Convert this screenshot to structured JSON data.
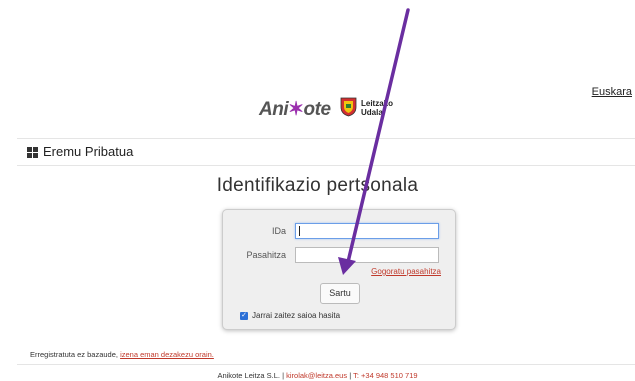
{
  "language": "Euskara",
  "logos": {
    "anikote_left": "Ani",
    "anikote_right": "ote",
    "leitzako_line1": "Leitzako",
    "leitzako_line2": "Udala"
  },
  "section": {
    "title": "Eremu Pribatua",
    "icon": "grid-icon"
  },
  "page_title": "Identifikazio pertsonala",
  "login": {
    "id_label": "IDa",
    "id_value": "",
    "password_label": "Pasahitza",
    "password_value": "",
    "forgot_link": "Gogoratu pasahitza",
    "submit_label": "Sartu",
    "keep_logged_in_label": "Jarrai zaitez saioa hasita",
    "keep_logged_in_checked": true
  },
  "register": {
    "text": "Erregistratuta ez bazaude,",
    "link": "izena eman dezakezu orain."
  },
  "footer": {
    "company": "Anikote Leitza S.L.",
    "sep1": "|",
    "email": "kirolak@leitza.eus",
    "sep2": "|",
    "phone": "T: +34 948 510 719"
  },
  "colors": {
    "accent_link": "#c0392b",
    "checkbox": "#2b6fd6",
    "annotation_arrow": "#6a2ea0",
    "anikote_star": "#9b2fae"
  }
}
